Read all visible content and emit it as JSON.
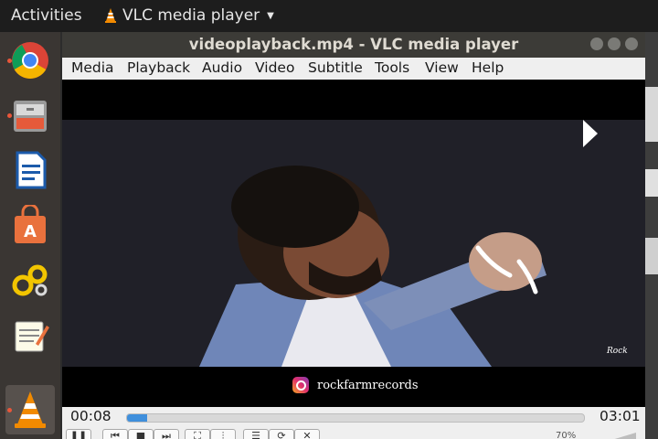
{
  "topbar": {
    "activities_label": "Activities",
    "app_menu_label": "VLC media player"
  },
  "dock": {
    "items": [
      "chrome-icon",
      "files-icon",
      "writer-icon",
      "software-store-icon",
      "settings-cogs-icon",
      "text-editor-icon",
      "vlc-icon"
    ],
    "running_indicator_color": "#e9563a"
  },
  "window": {
    "title": "videoplayback.mp4 - VLC media player",
    "menu": [
      "Media",
      "Playback",
      "Audio",
      "Video",
      "Subtitle",
      "Tools",
      "View",
      "Help"
    ]
  },
  "video": {
    "instagram_handle": "rockfarmrecords",
    "logo_text": "Rock"
  },
  "playback": {
    "elapsed": "00:08",
    "total": "03:01",
    "progress_fraction": 0.044,
    "volume": "70%",
    "accent_color": "#3f8fdc"
  }
}
